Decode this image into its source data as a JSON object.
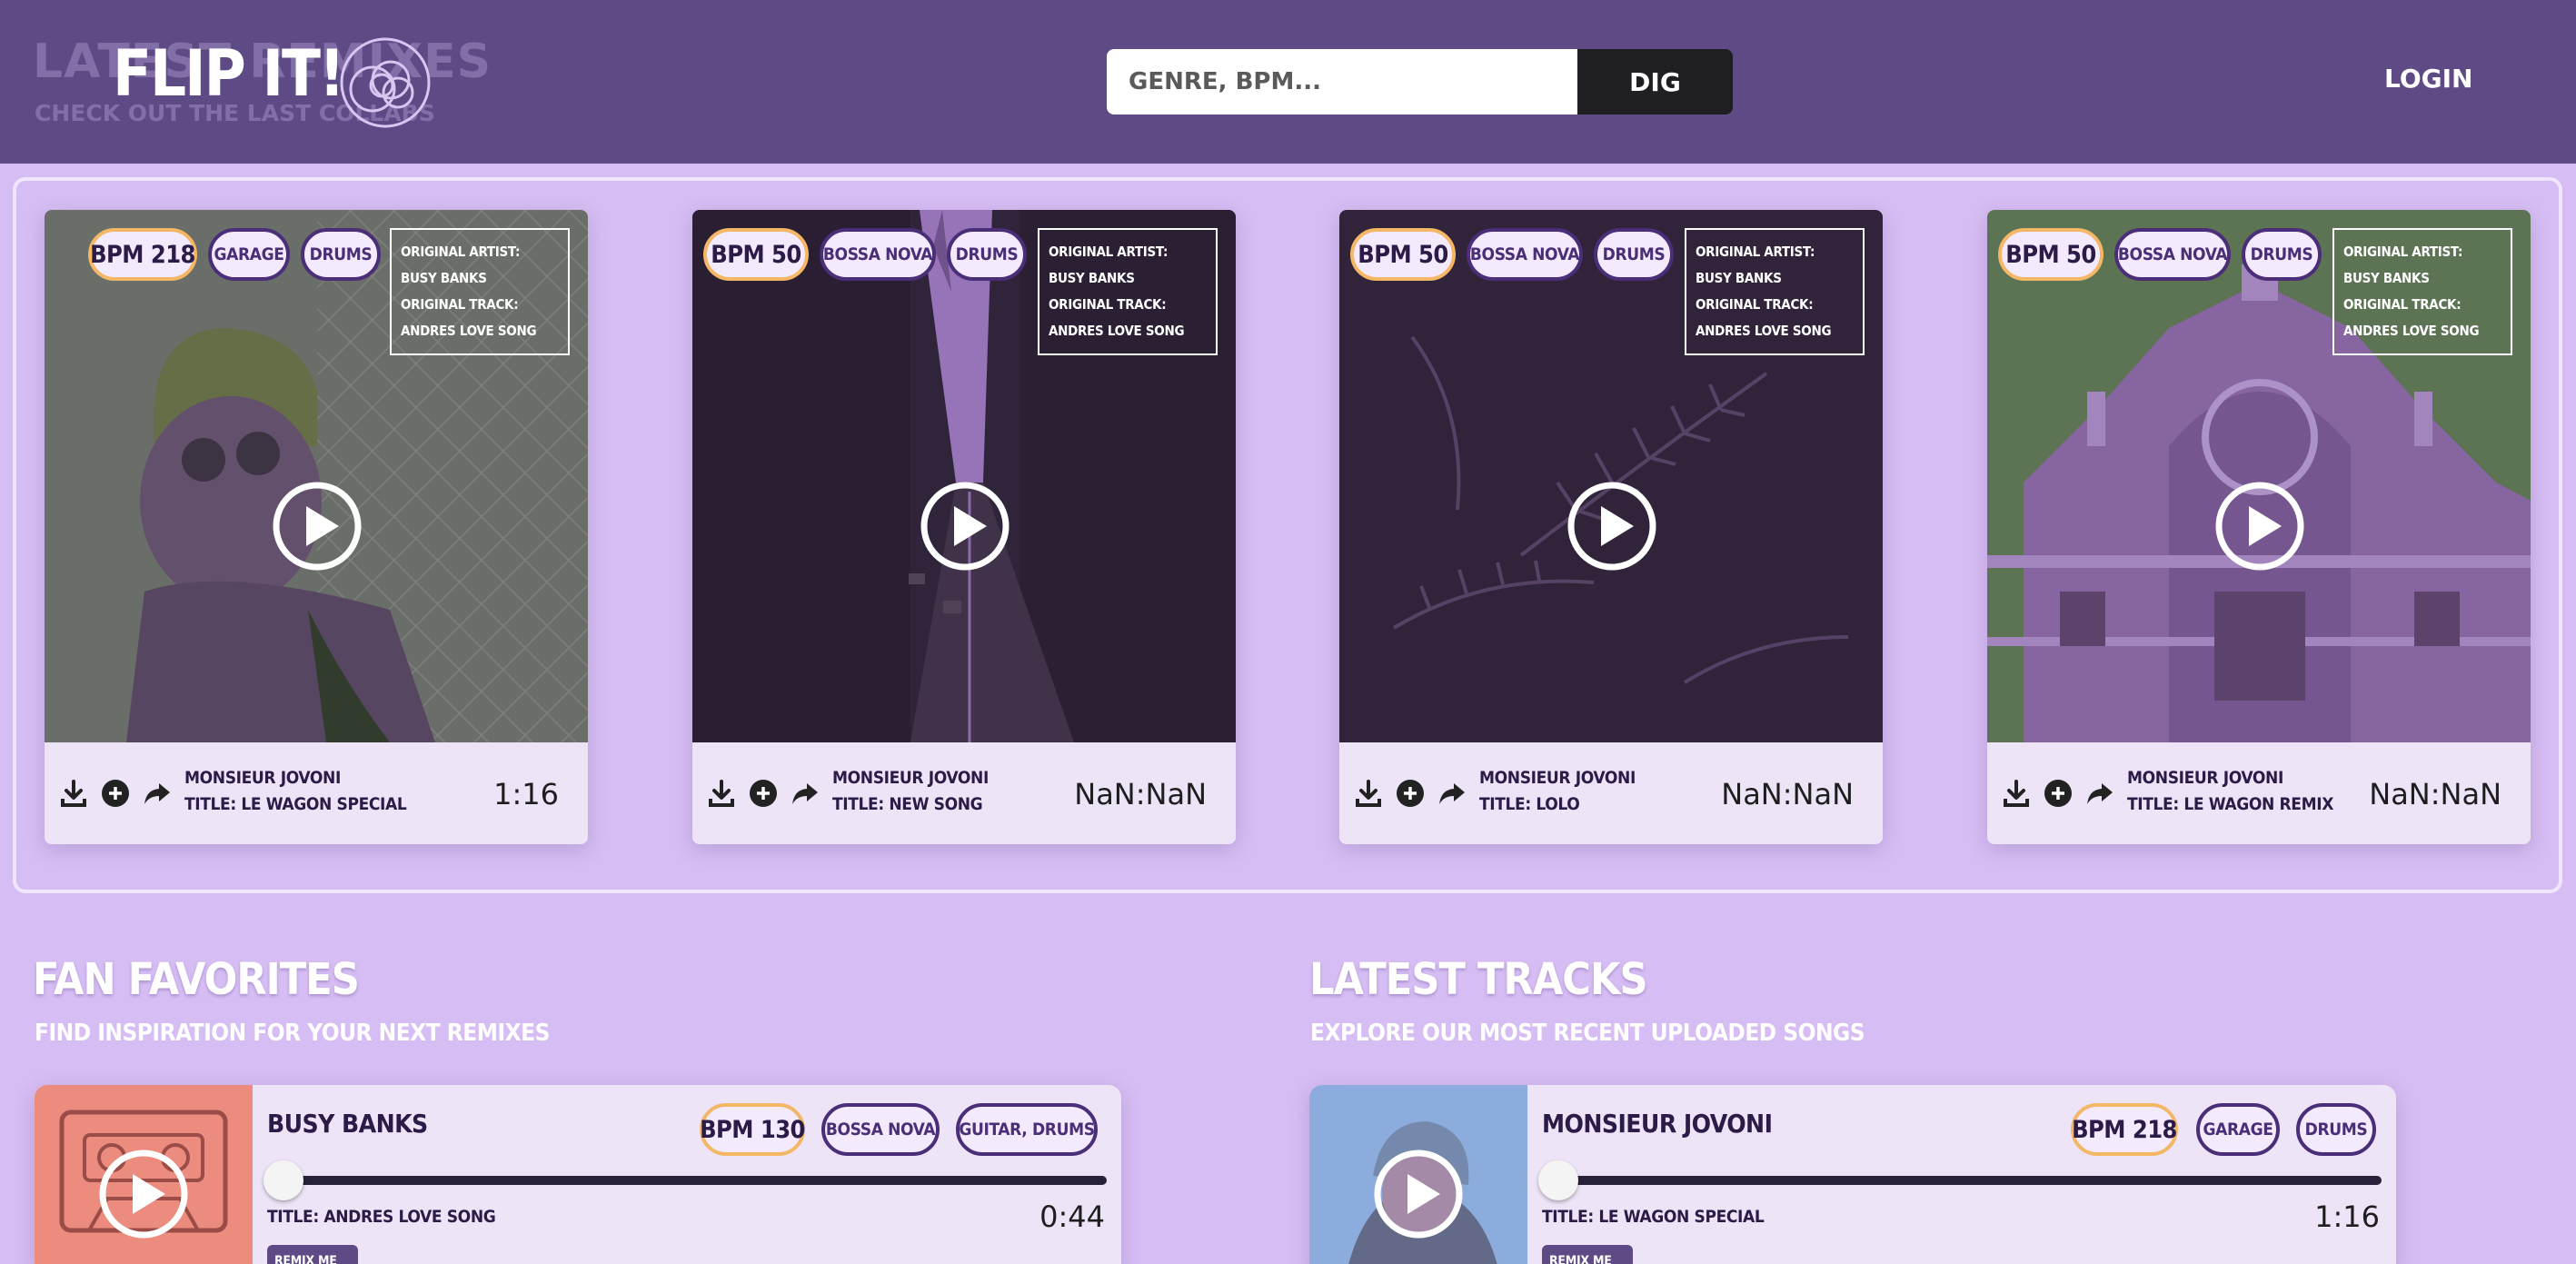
{
  "navbar": {
    "ghost_title": "LATEST REMIXES",
    "ghost_subtitle": "CHECK OUT THE LAST COLLABS",
    "logo_text": "FLIP IT!",
    "search_placeholder": "GENRE, BPM...",
    "search_button": "DIG",
    "login_label": "LOGIN",
    "colors": {
      "background": "#5e4a85",
      "button": "#1f1f23"
    }
  },
  "remixes": [
    {
      "bpm": "BPM 218",
      "genres": [
        "GARAGE",
        "DRUMS"
      ],
      "original_artist": "ORIGINAL ARTIST: BUSY BANKS",
      "original_track": "ORIGINAL TRACK: ANDRES LOVE SONG",
      "artist": "MONSIEUR JOVONI",
      "title": "TITLE: LE WAGON SPECIAL",
      "time": "1:16",
      "progress": 0,
      "art": "portrait-man-with-beanie"
    },
    {
      "bpm": "BPM 50",
      "genres": [
        "BOSSA NOVA",
        "DRUMS"
      ],
      "original_artist": "ORIGINAL ARTIST: BUSY BANKS",
      "original_track": "ORIGINAL TRACK: ANDRES LOVE SONG",
      "artist": "MONSIEUR JOVONI",
      "title": "TITLE: NEW SONG",
      "time": "NaN:NaN",
      "progress": 0,
      "art": "city-street-skyscrapers"
    },
    {
      "bpm": "BPM 50",
      "genres": [
        "BOSSA NOVA",
        "DRUMS"
      ],
      "original_artist": "ORIGINAL ARTIST: BUSY BANKS",
      "original_track": "ORIGINAL TRACK: ANDRES LOVE SONG",
      "artist": "MONSIEUR JOVONI",
      "title": "TITLE: LOLO",
      "time": "NaN:NaN",
      "progress": 0,
      "art": "dark-ferns"
    },
    {
      "bpm": "BPM 50",
      "genres": [
        "BOSSA NOVA",
        "DRUMS"
      ],
      "original_artist": "ORIGINAL ARTIST: BUSY BANKS",
      "original_track": "ORIGINAL TRACK: ANDRES LOVE SONG",
      "artist": "MONSIEUR JOVONI",
      "title": "TITLE: LE WAGON REMIX",
      "time": "NaN:NaN",
      "progress": 0,
      "art": "ornate-building-facade"
    }
  ],
  "fan_favorites": {
    "heading": "FAN FAVORITES",
    "subheading": "FIND INSPIRATION FOR YOUR NEXT REMIXES",
    "track": {
      "name": "BUSY BANKS",
      "bpm": "BPM 130",
      "genres": [
        "BOSSA NOVA",
        "GUITAR, DRUMS"
      ],
      "title": "TITLE: ANDRES LOVE SONG",
      "time": "0:44",
      "progress": 0,
      "art": "cassette-tape",
      "remix_button": "REMIX ME"
    }
  },
  "latest_tracks": {
    "heading": "LATEST TRACKS",
    "subheading": "EXPLORE OUR MOST RECENT UPLOADED SONGS",
    "track": {
      "name": "MONSIEUR JOVONI",
      "bpm": "BPM 218",
      "genres": [
        "GARAGE",
        "DRUMS"
      ],
      "title": "TITLE: LE WAGON SPECIAL",
      "time": "1:16",
      "progress": 0,
      "art": "portrait-man-with-beanie",
      "remix_button": "REMIX ME"
    }
  },
  "colors": {
    "page_background": "#d6bdf3",
    "bpm_tag_border": "#f3b765",
    "genre_tag_border": "#4a2e77",
    "card_footer": "#ede4f7"
  }
}
